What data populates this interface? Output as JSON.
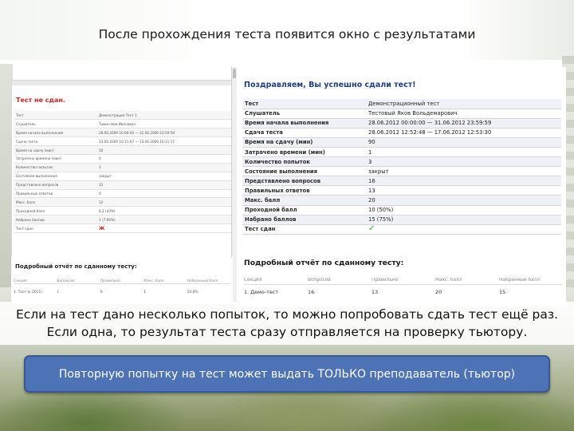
{
  "slide": {
    "title": "После прохождения теста появится окно с результатами",
    "caption_line1": "Если на тест дано несколько попыток, то можно попробовать сдать тест ещё раз.",
    "caption_line2": "Если одна, то результат теста сразу отправляется на проверку тьютору.",
    "note": "Повторную попытку на тест может выдать ТОЛЬКО преподаватель (тьютор)"
  },
  "left_screenshot": {
    "status_title": "Тест не сдан.",
    "rows": [
      {
        "key": "Тест",
        "value": "Демонстрация Тест 1"
      },
      {
        "key": "Слушатель",
        "value": "Тамин Ник Иванович"
      },
      {
        "key": "Время начала выполнения",
        "value": "28.06.2009 10:00:00 — 31.06.2009 23:59:59"
      },
      {
        "key": "Сдача теста",
        "value": "13.06.2009 10:11:07 — 13.06.2009 10:11:17"
      },
      {
        "key": "Время на сдачу (мин)",
        "value": "10"
      },
      {
        "key": "Затрачено времени (мин)",
        "value": "0"
      },
      {
        "key": "Количество попыток",
        "value": "1"
      },
      {
        "key": "Состояние выполнения",
        "value": "закрыт"
      },
      {
        "key": "Представлено вопросов",
        "value": "12"
      },
      {
        "key": "Правильных ответов",
        "value": "0"
      },
      {
        "key": "Макс. балл",
        "value": "12"
      },
      {
        "key": "Проходной балл",
        "value": "8,2 (43%)"
      },
      {
        "key": "Набрано баллов",
        "value": "1 (7.69%)"
      },
      {
        "key": "Тест сдан",
        "value": "Ж"
      }
    ],
    "detail_title": "Подробный отчёт по сданному тесту:",
    "detail_headers": [
      "Секция",
      "Вопросов",
      "Правильно",
      "Макс. балл",
      "Набранный балл"
    ],
    "detail_row": [
      "1. Тест (к 2011)",
      "1",
      "0",
      "1",
      "10.6%"
    ]
  },
  "right_screenshot": {
    "success_title": "Поздравляем, Вы успешно сдали тест!",
    "rows": [
      {
        "key": "Тест",
        "value": "Демонстрационный тест"
      },
      {
        "key": "Слушатель",
        "value": "Тестовый Яков Вольдемарович"
      },
      {
        "key": "Время начала выполнения",
        "value": "28.06.2012 00:00:00 — 31.06.2012 23:59:59"
      },
      {
        "key": "Сдача теста",
        "value": "28.06.2012 12:52:48 — 17.06.2012 12:53:30"
      },
      {
        "key": "Время на сдачу (мин)",
        "value": "90"
      },
      {
        "key": "Затрачено времени (мин)",
        "value": "1"
      },
      {
        "key": "Количество попыток",
        "value": "3"
      },
      {
        "key": "Состояние выполнения",
        "value": "закрыт"
      },
      {
        "key": "Представлено вопросов",
        "value": "16"
      },
      {
        "key": "Правильных ответов",
        "value": "13"
      },
      {
        "key": "Макс. балл",
        "value": "20"
      },
      {
        "key": "Проходной балл",
        "value": "10 (50%)"
      },
      {
        "key": "Набрано баллов",
        "value": "15 (75%)"
      },
      {
        "key": "Тест сдан",
        "value": "✓"
      }
    ],
    "detail_title": "Подробный отчёт по сданному тесту:",
    "detail_headers": [
      "Секция",
      "Вопросов",
      "Правильно",
      "Макс. балл",
      "Набранный балл"
    ],
    "detail_row": [
      "1. Демо-тест",
      "16",
      "13",
      "20",
      "15"
    ]
  },
  "colors": {
    "note_background": "#4d72b5",
    "fail_text": "#c62828",
    "success_title": "#1f3f7a",
    "check": "#2ea82e"
  }
}
